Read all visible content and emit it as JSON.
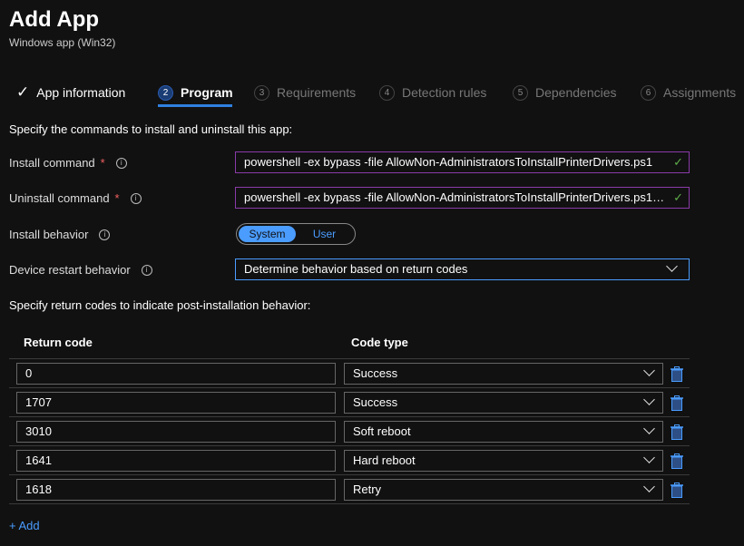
{
  "header": {
    "title": "Add App",
    "subtitle": "Windows app (Win32)"
  },
  "tabs": [
    {
      "num": "",
      "label": "App information",
      "state": "done"
    },
    {
      "num": "2",
      "label": "Program",
      "state": "active"
    },
    {
      "num": "3",
      "label": "Requirements"
    },
    {
      "num": "4",
      "label": "Detection rules"
    },
    {
      "num": "5",
      "label": "Dependencies"
    },
    {
      "num": "6",
      "label": "Assignments"
    }
  ],
  "intro": "Specify the commands to install and uninstall this app:",
  "form": {
    "install_label": "Install command",
    "install_value": "powershell -ex bypass -file AllowNon-AdministratorsToInstallPrinterDrivers.ps1",
    "uninstall_label": "Uninstall command",
    "uninstall_value": "powershell -ex bypass -file AllowNon-AdministratorsToInstallPrinterDrivers.ps1 -...",
    "required_mark": "*",
    "behavior_label": "Install behavior",
    "behavior_options": [
      "System",
      "User"
    ],
    "behavior_selected": "System",
    "restart_label": "Device restart behavior",
    "restart_value": "Determine behavior based on return codes"
  },
  "return_intro": "Specify return codes to indicate post-installation behavior:",
  "table": {
    "headers": [
      "Return code",
      "Code type"
    ],
    "rows": [
      {
        "code": "0",
        "type": "Success"
      },
      {
        "code": "1707",
        "type": "Success"
      },
      {
        "code": "3010",
        "type": "Soft reboot"
      },
      {
        "code": "1641",
        "type": "Hard reboot"
      },
      {
        "code": "1618",
        "type": "Retry"
      }
    ]
  },
  "add_label": "+ Add",
  "colors": {
    "accent": "#4a9cff",
    "field_border": "#8a3aa8",
    "valid": "#5fae4a",
    "bg": "#111111"
  }
}
